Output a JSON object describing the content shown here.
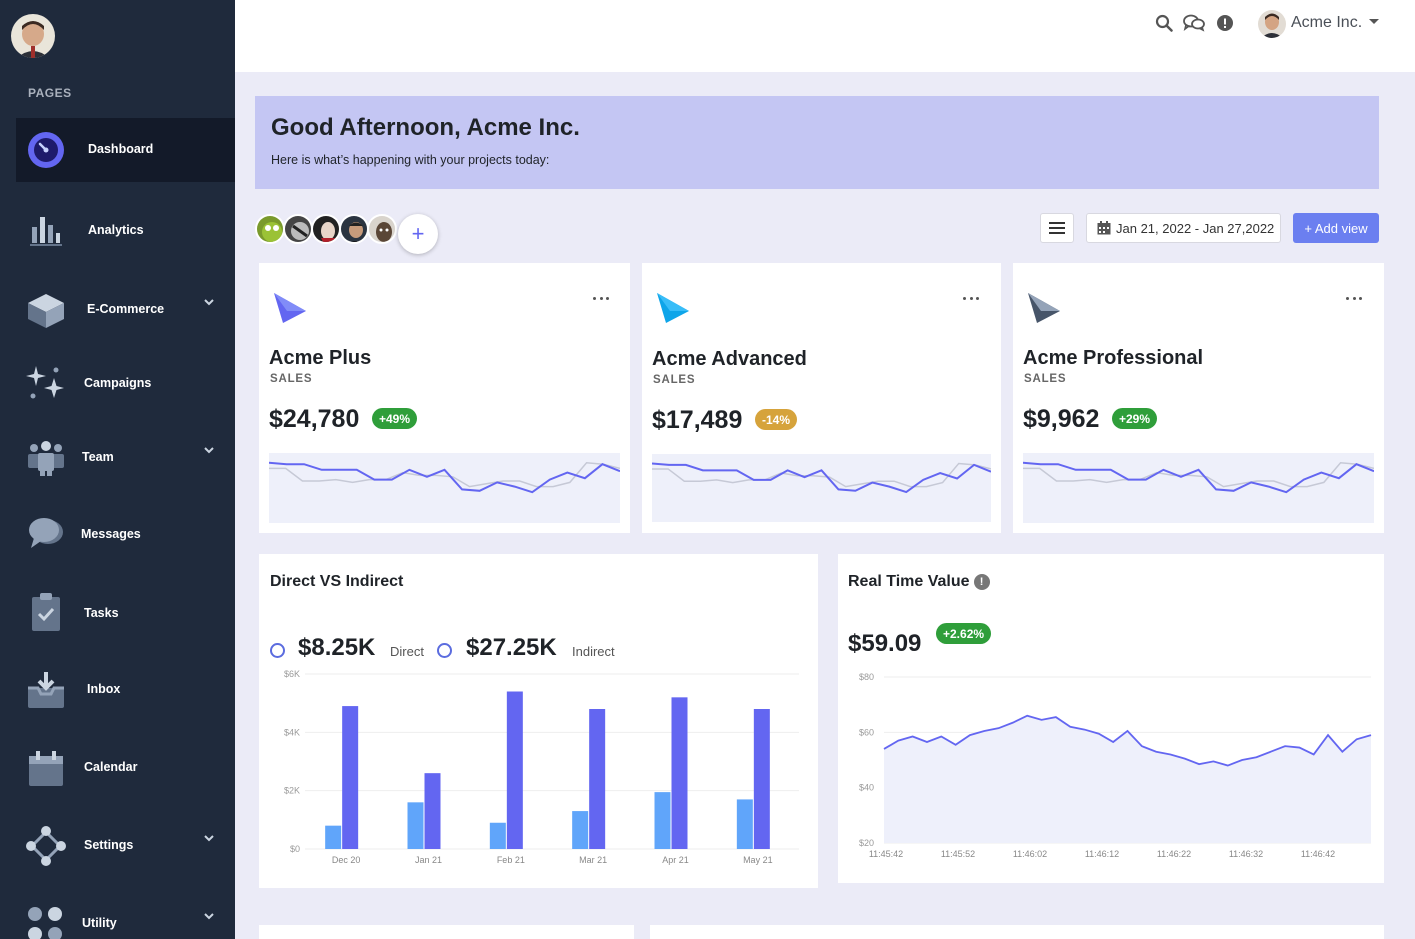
{
  "sidebar": {
    "section_title": "PAGES",
    "items": [
      {
        "label": "Dashboard",
        "icon": "dashboard-icon"
      },
      {
        "label": "Analytics",
        "icon": "analytics-icon"
      },
      {
        "label": "E-Commerce",
        "icon": "ecommerce-icon"
      },
      {
        "label": "Campaigns",
        "icon": "campaigns-icon"
      },
      {
        "label": "Team",
        "icon": "team-icon"
      },
      {
        "label": "Messages",
        "icon": "messages-icon"
      },
      {
        "label": "Tasks",
        "icon": "tasks-icon"
      },
      {
        "label": "Inbox",
        "icon": "inbox-icon"
      },
      {
        "label": "Calendar",
        "icon": "calendar-icon"
      },
      {
        "label": "Settings",
        "icon": "settings-icon"
      },
      {
        "label": "Utility",
        "icon": "utility-icon"
      }
    ]
  },
  "topbar": {
    "user_name": "Acme Inc."
  },
  "banner": {
    "title": "Good Afternoon, Acme Inc.",
    "subtitle": "Here is what’s happening with your projects today:"
  },
  "toolbar": {
    "add_member": "+",
    "date_range": "Jan 21, 2022 - Jan 27,2022",
    "add_view": "+ Add view"
  },
  "products": [
    {
      "name": "Acme Plus",
      "sub": "SALES",
      "value": "$24,780",
      "badge": "+49%",
      "badge_color": "#2f9e3a"
    },
    {
      "name": "Acme Advanced",
      "sub": "SALES",
      "value": "$17,489",
      "badge": "-14%",
      "badge_color": "#d6a33b"
    },
    {
      "name": "Acme Professional",
      "sub": "SALES",
      "value": "$9,962",
      "badge": "+29%",
      "badge_color": "#2f9e3a"
    }
  ],
  "direct_indirect": {
    "title": "Direct VS Indirect",
    "direct_value": "$8.25K",
    "direct_label": "Direct",
    "indirect_value": "$27.25K",
    "indirect_label": "Indirect"
  },
  "realtime": {
    "title": "Real Time Value",
    "value": "$59.09",
    "badge": "+2.62%"
  },
  "chart_data": [
    {
      "type": "bar",
      "categories": [
        "Dec 20",
        "Jan 21",
        "Feb 21",
        "Mar 21",
        "Apr 21",
        "May 21"
      ],
      "series": [
        {
          "name": "Direct",
          "values": [
            800,
            1600,
            900,
            1300,
            1950,
            1700
          ],
          "color": "#60a5fa"
        },
        {
          "name": "Indirect",
          "values": [
            4900,
            2600,
            5400,
            4800,
            5200,
            4800
          ],
          "color": "#6366f1"
        }
      ],
      "yticks": [
        "$0",
        "$2K",
        "$4K",
        "$6K"
      ],
      "ylim": [
        0,
        6000
      ]
    },
    {
      "type": "area",
      "x": [
        "11:45:42",
        "11:45:52",
        "11:46:02",
        "11:46:12",
        "11:46:22",
        "11:46:32",
        "11:46:42"
      ],
      "values": [
        54,
        57,
        58.5,
        56.5,
        58.5,
        55.5,
        59,
        60.5,
        61.5,
        63.5,
        66,
        64.5,
        65.5,
        62,
        61,
        59.5,
        56.5,
        60.5,
        55,
        53,
        52,
        50.5,
        48.5,
        49.5,
        48,
        50,
        51,
        53,
        55,
        54.5,
        52,
        59,
        53,
        57.5,
        59
      ],
      "yticks": [
        "$20",
        "$40",
        "$60",
        "$80"
      ],
      "ylim": [
        20,
        80
      ],
      "color": "#6366f1"
    }
  ],
  "sparklines": {
    "main": [
      86,
      84,
      84,
      76,
      76,
      76,
      62,
      62,
      76,
      66,
      76,
      48,
      46,
      58,
      52,
      44,
      62,
      72,
      64,
      84,
      74
    ],
    "ghost": [
      78,
      78,
      60,
      60,
      62,
      58,
      62,
      62,
      72,
      68,
      68,
      66,
      52,
      56,
      60,
      60,
      52,
      52,
      58,
      86,
      84,
      78
    ]
  }
}
